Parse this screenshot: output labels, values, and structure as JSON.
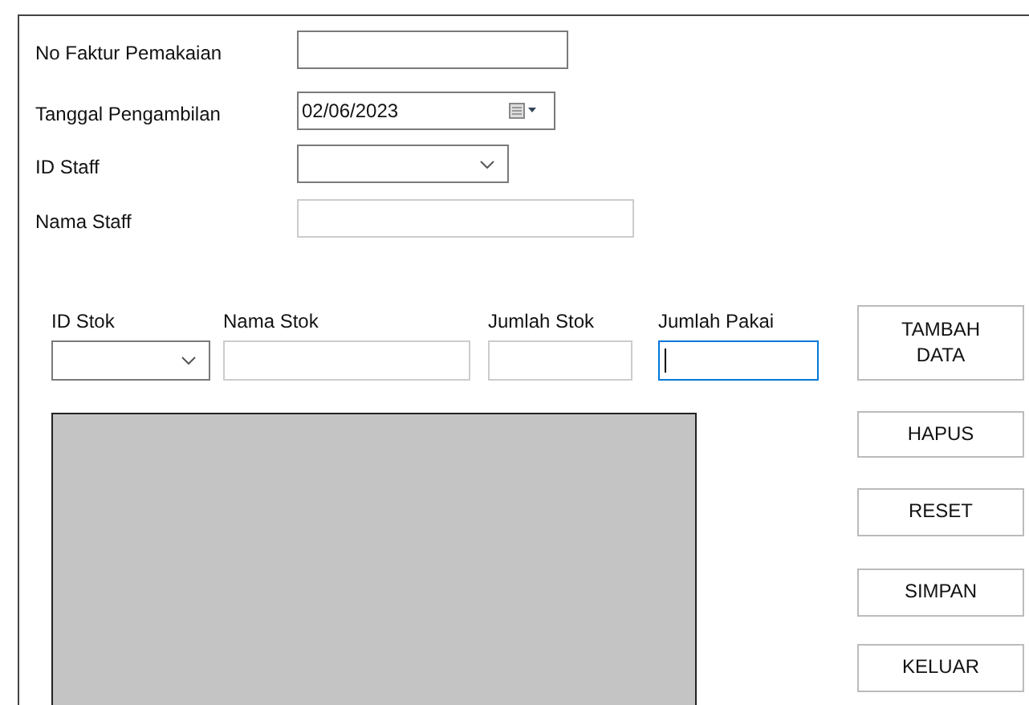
{
  "form_fields": [
    {
      "label": "No Faktur Pemakaian",
      "kind": "text",
      "disabled": false
    },
    {
      "label": "Tanggal Pengambilan",
      "kind": "date",
      "disabled": false,
      "value": "02/06/2023"
    },
    {
      "label": "ID Staff",
      "kind": "combo",
      "disabled": false
    },
    {
      "label": "Nama Staff",
      "kind": "text",
      "disabled": true
    }
  ],
  "item_fields": [
    {
      "label": "ID Stok",
      "kind": "combo",
      "disabled": false,
      "focused": false
    },
    {
      "label": "Nama Stok",
      "kind": "text",
      "disabled": true,
      "focused": false
    },
    {
      "label": "Jumlah Stok",
      "kind": "text",
      "disabled": true,
      "focused": false
    },
    {
      "label": "Jumlah Pakai",
      "kind": "text",
      "disabled": false,
      "focused": true
    }
  ],
  "buttons": [
    "TAMBAH DATA",
    "HAPUS",
    "RESET",
    "SIMPAN",
    "KELUAR"
  ]
}
